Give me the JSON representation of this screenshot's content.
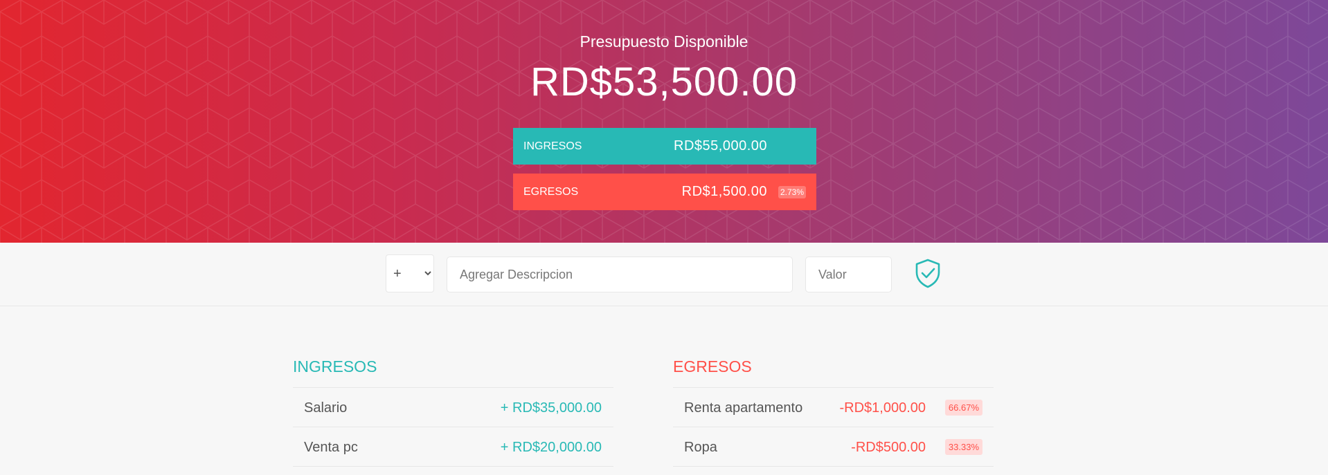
{
  "budget": {
    "title": "Presupuesto Disponible",
    "value": "RD$53,500.00"
  },
  "summary": {
    "income": {
      "label": "INGRESOS",
      "value": "RD$55,000.00"
    },
    "expenses": {
      "label": "EGRESOS",
      "value": "RD$1,500.00",
      "percentage": "2.73%"
    }
  },
  "add_form": {
    "type_options": [
      "+",
      "-"
    ],
    "type_selected": "+",
    "description_placeholder": "Agregar Descripcion",
    "value_placeholder": "Valor",
    "submit_icon": "shield-check-icon"
  },
  "income_list": {
    "title": "INGRESOS",
    "items": [
      {
        "description": "Salario",
        "value": "+ RD$35,000.00"
      },
      {
        "description": "Venta pc",
        "value": "+ RD$20,000.00"
      }
    ]
  },
  "expense_list": {
    "title": "EGRESOS",
    "items": [
      {
        "description": "Renta apartamento",
        "value": "-RD$1,000.00",
        "percentage": "66.67%"
      },
      {
        "description": "Ropa",
        "value": "-RD$500.00",
        "percentage": "33.33%"
      }
    ]
  },
  "colors": {
    "income": "#28b9b5",
    "expense": "#ff5049",
    "gradient_start": "#e2262f",
    "gradient_end": "#7d4899"
  }
}
